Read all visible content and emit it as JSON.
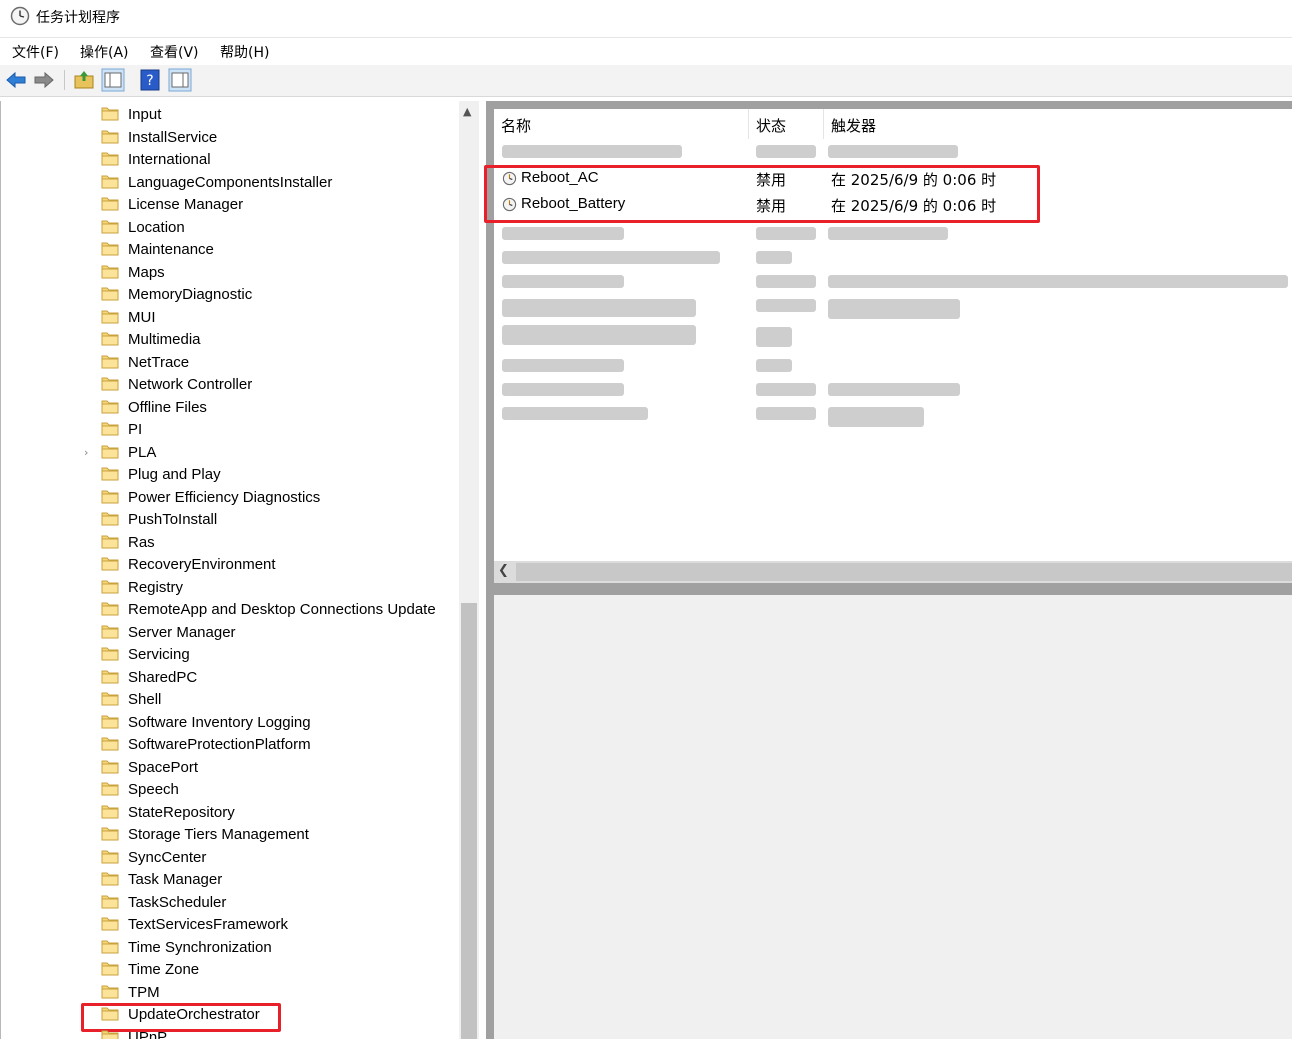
{
  "window": {
    "title": "任务计划程序",
    "icon": "clock-icon"
  },
  "menu": [
    "文件(F)",
    "操作(A)",
    "查看(V)",
    "帮助(H)"
  ],
  "toolbar": {
    "buttons": [
      "back-arrow-icon",
      "forward-arrow-icon",
      "folder-up-icon",
      "console-tree-icon",
      "help-icon",
      "action-pane-icon"
    ]
  },
  "tree": {
    "items": [
      "Input",
      "InstallService",
      "International",
      "LanguageComponentsInstaller",
      "License Manager",
      "Location",
      "Maintenance",
      "Maps",
      "MemoryDiagnostic",
      "MUI",
      "Multimedia",
      "NetTrace",
      "Network Controller",
      "Offline Files",
      "PI",
      "PLA",
      "Plug and Play",
      "Power Efficiency Diagnostics",
      "PushToInstall",
      "Ras",
      "RecoveryEnvironment",
      "Registry",
      "RemoteApp and Desktop Connections Update",
      "Server Manager",
      "Servicing",
      "SharedPC",
      "Shell",
      "Software Inventory Logging",
      "SoftwareProtectionPlatform",
      "SpacePort",
      "Speech",
      "StateRepository",
      "Storage Tiers Management",
      "SyncCenter",
      "Task Manager",
      "TaskScheduler",
      "TextServicesFramework",
      "Time Synchronization",
      "Time Zone",
      "TPM",
      "UpdateOrchestrator",
      "UPnP"
    ],
    "expandable_item": "PLA",
    "selected_item": "UpdateOrchestrator"
  },
  "task_list": {
    "columns": [
      "名称",
      "状态",
      "触发器"
    ],
    "rows": [
      {
        "name": "Reboot_AC",
        "status": "禁用",
        "trigger": "在 2025/6/9 的 0:06 时"
      },
      {
        "name": "Reboot_Battery",
        "status": "禁用",
        "trigger": "在 2025/6/9 的 0:06 时"
      }
    ]
  },
  "colors": {
    "highlight": "#e8202a",
    "pane_border": "#a0a0a0",
    "folder": "#f5d77a"
  }
}
